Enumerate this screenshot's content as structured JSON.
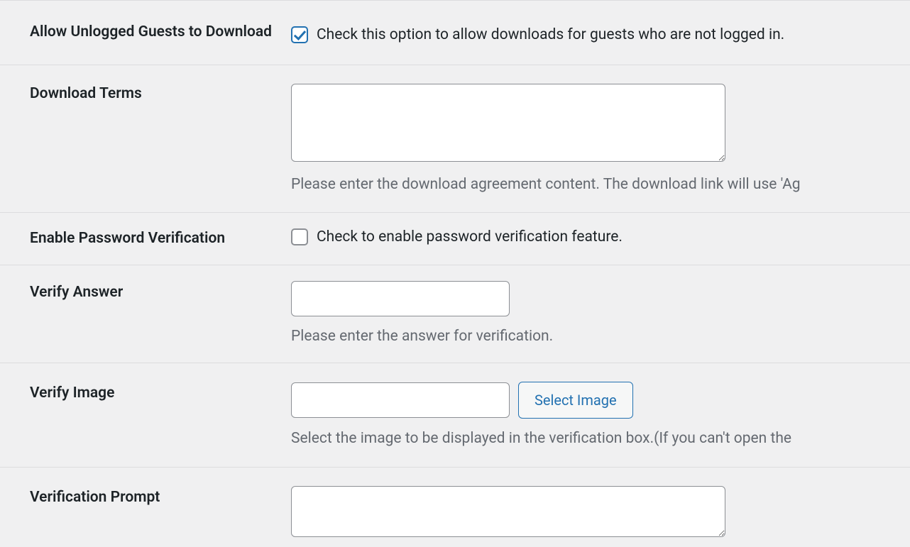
{
  "rows": {
    "allow_guests": {
      "label": "Allow Unlogged Guests to Download",
      "checked": true,
      "checkbox_label": "Check this option to allow downloads for guests who are not logged in."
    },
    "download_terms": {
      "label": "Download Terms",
      "value": "",
      "description": "Please enter the download agreement content. The download link will use 'Ag"
    },
    "enable_password": {
      "label": "Enable Password Verification",
      "checked": false,
      "checkbox_label": "Check to enable password verification feature."
    },
    "verify_answer": {
      "label": "Verify Answer",
      "value": "",
      "description": "Please enter the answer for verification."
    },
    "verify_image": {
      "label": "Verify Image",
      "value": "",
      "button_label": "Select Image",
      "description": "Select the image to be displayed in the verification box.(If you can't open the "
    },
    "verification_prompt": {
      "label": "Verification Prompt",
      "value": ""
    }
  }
}
